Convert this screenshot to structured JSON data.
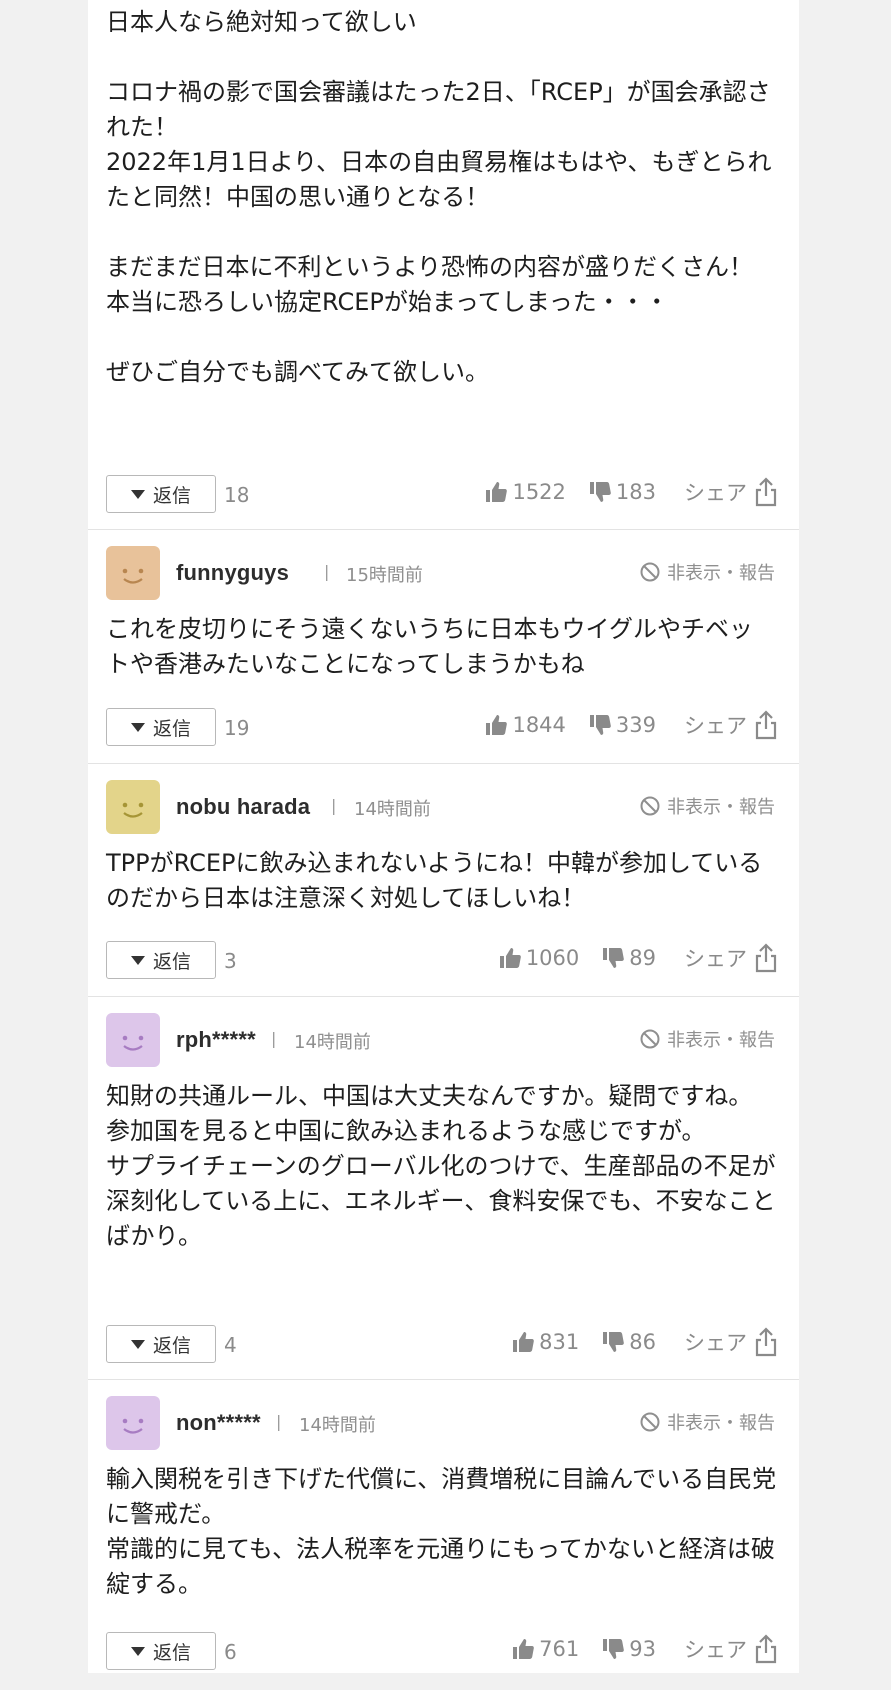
{
  "labels": {
    "reply": "返信",
    "share": "シェア",
    "hide_report": "非表示・報告",
    "separator": "|"
  },
  "comments": [
    {
      "body": "日本人なら絶対知って欲しい\n\nコロナ禍の影で国会審議はたった2日、「RCEP」が国会承認された！\n2022年1月1日より、日本の自由貿易権はもはや、もぎとられたと同然！中国の思い通りとなる！\n\nまだまだ日本に不利というより恐怖の内容が盛りだくさん！\n本当に恐ろしい協定RCEPが始まってしまった・・・\n\nぜひご自分でも調べてみて欲しい。",
      "replies": "18",
      "likes": "1522",
      "dislikes": "183"
    },
    {
      "user": "funnyguys",
      "time": "15時間前",
      "avatar_color": "#e8c29a",
      "body": "これを皮切りにそう遠くないうちに日本もウイグルやチベットや香港みたいなことになってしまうかもね",
      "replies": "19",
      "likes": "1844",
      "dislikes": "339"
    },
    {
      "user": "nobu harada",
      "time": "14時間前",
      "avatar_color": "#e3d48a",
      "body": "TPPがRCEPに飲み込まれないようにね！中韓が参加しているのだから日本は注意深く対処してほしいね！",
      "replies": "3",
      "likes": "1060",
      "dislikes": "89"
    },
    {
      "user": "rph*****",
      "time": "14時間前",
      "avatar_color": "#ddc6ea",
      "body": "知財の共通ルール、中国は大丈夫なんですか。疑問ですね。\n参加国を見ると中国に飲み込まれるような感じですが。\nサプライチェーンのグローバル化のつけで、生産部品の不足が深刻化している上に、エネルギー、食料安保でも、不安なことばかり。",
      "replies": "4",
      "likes": "831",
      "dislikes": "86"
    },
    {
      "user": "non*****",
      "time": "14時間前",
      "avatar_color": "#ddc6ea",
      "body": "輸入関税を引き下げた代償に、消費増税に目論んでいる自民党に警戒だ。\n常識的に見ても、法人税率を元通りにもってかないと経済は破綻する。",
      "replies": "6",
      "likes": "761",
      "dislikes": "93"
    }
  ]
}
